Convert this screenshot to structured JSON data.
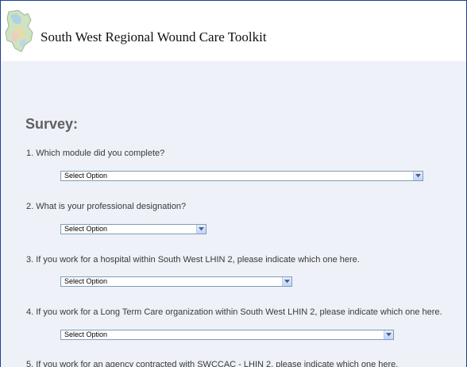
{
  "header": {
    "title": "South West Regional Wound Care Toolkit",
    "logo": "ontario-map-icon"
  },
  "survey": {
    "heading": "Survey:",
    "questions": [
      {
        "label": "1.  Which module did you complete?",
        "select": "Select Option"
      },
      {
        "label": "2.  What is your professional designation?",
        "select": "Select Option"
      },
      {
        "label": "3.  If you work for a hospital within South West LHIN 2, please indicate which one here.",
        "select": "Select Option"
      },
      {
        "label": "4.  If you work for a Long Term Care organization within South West LHIN 2, please indicate which one here.",
        "select": "Select Option"
      },
      {
        "label": "5.  If you work for an agency contracted with SWCCAC - LHIN 2, please indicate which one here."
      }
    ]
  },
  "colors": {
    "border": "#1c3f95",
    "content_bg": "#eef1f8",
    "heading": "#5f5f5f"
  }
}
